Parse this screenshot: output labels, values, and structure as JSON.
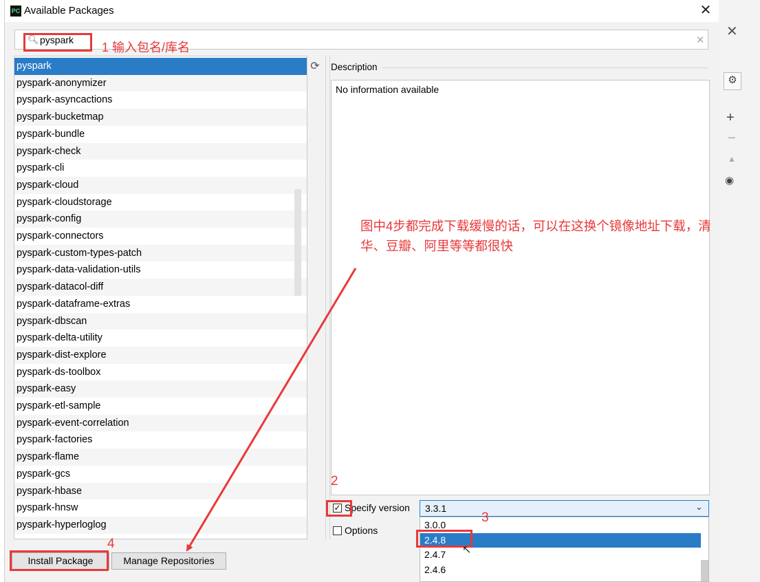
{
  "window": {
    "title": "Available Packages",
    "app_icon": "PC"
  },
  "search": {
    "value": "pyspark"
  },
  "packages": [
    "pyspark",
    "pyspark-anonymizer",
    "pyspark-asyncactions",
    "pyspark-bucketmap",
    "pyspark-bundle",
    "pyspark-check",
    "pyspark-cli",
    "pyspark-cloud",
    "pyspark-cloudstorage",
    "pyspark-config",
    "pyspark-connectors",
    "pyspark-custom-types-patch",
    "pyspark-data-validation-utils",
    "pyspark-datacol-diff",
    "pyspark-dataframe-extras",
    "pyspark-dbscan",
    "pyspark-delta-utility",
    "pyspark-dist-explore",
    "pyspark-ds-toolbox",
    "pyspark-easy",
    "pyspark-etl-sample",
    "pyspark-event-correlation",
    "pyspark-factories",
    "pyspark-flame",
    "pyspark-gcs",
    "pyspark-hbase",
    "pyspark-hnsw",
    "pyspark-hyperloglog"
  ],
  "selected_package": "pyspark",
  "description": {
    "label": "Description",
    "text": "No information available"
  },
  "specify_version": {
    "label": "Specify version",
    "checked": true,
    "value": "3.3.1"
  },
  "options": {
    "label": "Options",
    "checked": false
  },
  "version_options": [
    "3.0.0",
    "2.4.8",
    "2.4.7",
    "2.4.6"
  ],
  "highlighted_version": "2.4.8",
  "buttons": {
    "install": "Install Package",
    "manage": "Manage Repositories"
  },
  "annotations": {
    "step1": "1 输入包名/库名",
    "step2": "2",
    "step3": "3",
    "step4": "4",
    "note_line1": "图中4步都完成下载缓慢的话，可以在这换个镜像地址下载，清",
    "note_line2": "华、豆瓣、阿里等等都很快"
  },
  "colors": {
    "selection": "#2a7cc7",
    "annotation_red": "#e8383a"
  },
  "icons": [
    "pycharm-app-icon",
    "close-icon",
    "search-icon",
    "clear-icon",
    "refresh-icon",
    "chevron-down-icon",
    "gear-icon",
    "plus-icon",
    "minus-icon",
    "up-icon",
    "eye-icon",
    "mouse-cursor-icon"
  ]
}
